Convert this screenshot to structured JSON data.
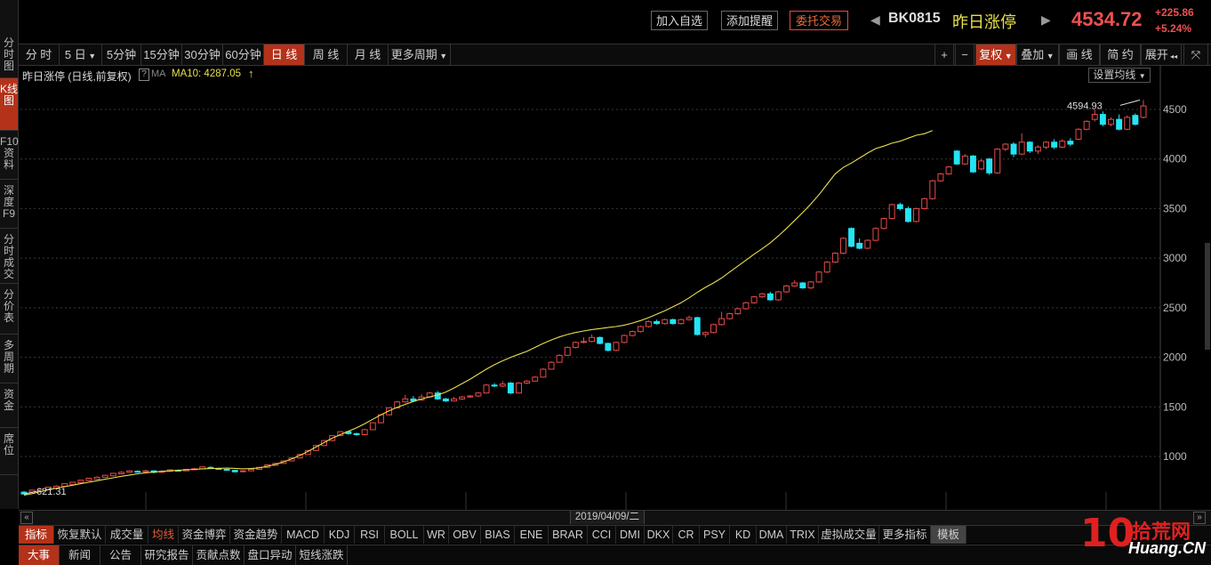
{
  "left_tabs": [
    "分时图",
    "K线图",
    "F10资料",
    "深度F9",
    "分时成交",
    "分价表",
    "多周期",
    "资金",
    "席位"
  ],
  "left_active": "K线图",
  "header": {
    "btn_add_watch": "加入自选",
    "btn_add_alert": "添加提醒",
    "btn_trade": "委托交易",
    "code": "BK0815",
    "name": "昨日涨停",
    "price": "4534.72",
    "change": "+225.86",
    "change_pct": "+5.24%"
  },
  "periods": [
    "分 时",
    "5 日",
    "5分钟",
    "15分钟",
    "30分钟",
    "60分钟",
    "日 线",
    "周 线",
    "月 线",
    "更多周期"
  ],
  "period_active": "日 线",
  "right_toolbar": {
    "plus": "+",
    "minus": "−",
    "adjust": "复权",
    "overlay": "叠加",
    "draw": "画 线",
    "simple": "简 约",
    "expand": "展开"
  },
  "chart_info": {
    "title": "昨日涨停 (日线,前复权)",
    "help": "?",
    "ma_label": "MA",
    "ma10": "MA10: 4287.05",
    "ma_arrow": "↑",
    "set_ma_btn": "设置均线",
    "high_label": "4594.93",
    "low_label": "621.31",
    "date_label": "2019/04/09/二"
  },
  "colors": {
    "up": "#e84a4a",
    "down": "#23e4f4",
    "ma": "#e8e04a",
    "accent": "#b4321a"
  },
  "chart_data": {
    "type": "candlestick",
    "title": "昨日涨停 (日线,前复权)",
    "ylim": [
      500,
      4700
    ],
    "yticks": [
      1000,
      1500,
      2000,
      2500,
      3000,
      3500,
      4000,
      4500
    ],
    "series": [
      {
        "name": "MA10",
        "values": [
          610,
          625,
          645,
          665,
          680,
          695,
          710,
          725,
          740,
          755,
          770,
          785,
          800,
          812,
          825,
          835,
          842,
          850,
          855,
          860,
          865,
          870,
          875,
          878,
          880,
          882,
          880,
          875,
          878,
          885,
          900,
          920,
          945,
          975,
          1010,
          1050,
          1095,
          1140,
          1185,
          1220,
          1255,
          1290,
          1330,
          1375,
          1420,
          1460,
          1495,
          1525,
          1555,
          1580,
          1600,
          1620,
          1650,
          1690,
          1735,
          1780,
          1830,
          1880,
          1925,
          1965,
          2000,
          2030,
          2060,
          2100,
          2140,
          2175,
          2205,
          2230,
          2250,
          2265,
          2280,
          2290,
          2300,
          2310,
          2325,
          2345,
          2370,
          2400,
          2435,
          2470,
          2510,
          2550,
          2600,
          2655,
          2705,
          2750,
          2800,
          2860,
          2920,
          2980,
          3040,
          3095,
          3155,
          3225,
          3300,
          3380,
          3460,
          3545,
          3640,
          3745,
          3850,
          3915,
          3960,
          4010,
          4060,
          4105,
          4130,
          4160,
          4180,
          4210,
          4240,
          4255,
          4287
        ]
      }
    ],
    "candles": [
      [
        640,
        621,
        650,
        615
      ],
      [
        640,
        660,
        665,
        630
      ],
      [
        650,
        670,
        680,
        645
      ],
      [
        665,
        690,
        695,
        660
      ],
      [
        680,
        700,
        710,
        675
      ],
      [
        700,
        725,
        730,
        695
      ],
      [
        715,
        740,
        745,
        710
      ],
      [
        735,
        760,
        765,
        730
      ],
      [
        755,
        780,
        785,
        750
      ],
      [
        770,
        790,
        800,
        765
      ],
      [
        790,
        810,
        815,
        785
      ],
      [
        805,
        830,
        835,
        800
      ],
      [
        825,
        840,
        850,
        820
      ],
      [
        840,
        855,
        860,
        835
      ],
      [
        850,
        845,
        860,
        835
      ],
      [
        845,
        855,
        865,
        840
      ],
      [
        855,
        840,
        860,
        830
      ],
      [
        840,
        850,
        860,
        835
      ],
      [
        850,
        865,
        870,
        845
      ],
      [
        860,
        855,
        870,
        850
      ],
      [
        855,
        870,
        875,
        850
      ],
      [
        870,
        875,
        885,
        860
      ],
      [
        875,
        895,
        900,
        870
      ],
      [
        890,
        880,
        900,
        875
      ],
      [
        880,
        870,
        885,
        865
      ],
      [
        870,
        860,
        880,
        855
      ],
      [
        860,
        845,
        865,
        840
      ],
      [
        850,
        855,
        860,
        840
      ],
      [
        855,
        870,
        875,
        850
      ],
      [
        870,
        890,
        895,
        865
      ],
      [
        890,
        915,
        920,
        885
      ],
      [
        910,
        930,
        935,
        905
      ],
      [
        930,
        955,
        960,
        925
      ],
      [
        955,
        985,
        990,
        950
      ],
      [
        985,
        1020,
        1025,
        980
      ],
      [
        1020,
        1060,
        1065,
        1015
      ],
      [
        1060,
        1110,
        1115,
        1055
      ],
      [
        1110,
        1160,
        1165,
        1105
      ],
      [
        1160,
        1210,
        1215,
        1155
      ],
      [
        1210,
        1250,
        1255,
        1205
      ],
      [
        1250,
        1230,
        1260,
        1220
      ],
      [
        1230,
        1220,
        1240,
        1210
      ],
      [
        1220,
        1270,
        1280,
        1215
      ],
      [
        1270,
        1340,
        1345,
        1265
      ],
      [
        1340,
        1420,
        1425,
        1335
      ],
      [
        1420,
        1490,
        1495,
        1415
      ],
      [
        1490,
        1550,
        1560,
        1485
      ],
      [
        1550,
        1580,
        1620,
        1540
      ],
      [
        1580,
        1560,
        1610,
        1550
      ],
      [
        1570,
        1600,
        1630,
        1560
      ],
      [
        1600,
        1640,
        1650,
        1590
      ],
      [
        1640,
        1580,
        1660,
        1570
      ],
      [
        1580,
        1560,
        1590,
        1550
      ],
      [
        1560,
        1580,
        1600,
        1555
      ],
      [
        1580,
        1600,
        1610,
        1570
      ],
      [
        1600,
        1610,
        1620,
        1590
      ],
      [
        1610,
        1640,
        1650,
        1600
      ],
      [
        1640,
        1720,
        1730,
        1635
      ],
      [
        1720,
        1710,
        1740,
        1700
      ],
      [
        1710,
        1730,
        1760,
        1700
      ],
      [
        1740,
        1640,
        1750,
        1630
      ],
      [
        1640,
        1740,
        1750,
        1635
      ],
      [
        1740,
        1760,
        1770,
        1730
      ],
      [
        1760,
        1800,
        1810,
        1755
      ],
      [
        1800,
        1880,
        1890,
        1795
      ],
      [
        1880,
        1950,
        1960,
        1875
      ],
      [
        1950,
        2020,
        2030,
        1945
      ],
      [
        2020,
        2100,
        2110,
        2015
      ],
      [
        2100,
        2150,
        2160,
        2090
      ],
      [
        2150,
        2160,
        2200,
        2140
      ],
      [
        2160,
        2200,
        2230,
        2150
      ],
      [
        2200,
        2140,
        2210,
        2130
      ],
      [
        2140,
        2070,
        2150,
        2060
      ],
      [
        2070,
        2150,
        2160,
        2060
      ],
      [
        2150,
        2220,
        2230,
        2140
      ],
      [
        2220,
        2260,
        2270,
        2210
      ],
      [
        2260,
        2310,
        2320,
        2250
      ],
      [
        2310,
        2360,
        2370,
        2300
      ],
      [
        2360,
        2340,
        2380,
        2330
      ],
      [
        2340,
        2380,
        2390,
        2330
      ],
      [
        2380,
        2340,
        2390,
        2330
      ],
      [
        2340,
        2380,
        2390,
        2330
      ],
      [
        2380,
        2400,
        2420,
        2370
      ],
      [
        2400,
        2230,
        2410,
        2220
      ],
      [
        2230,
        2250,
        2260,
        2200
      ],
      [
        2250,
        2330,
        2340,
        2240
      ],
      [
        2330,
        2390,
        2460,
        2320
      ],
      [
        2390,
        2440,
        2450,
        2380
      ],
      [
        2440,
        2490,
        2500,
        2430
      ],
      [
        2490,
        2550,
        2560,
        2480
      ],
      [
        2550,
        2610,
        2620,
        2540
      ],
      [
        2610,
        2640,
        2650,
        2600
      ],
      [
        2640,
        2580,
        2660,
        2570
      ],
      [
        2580,
        2660,
        2670,
        2570
      ],
      [
        2660,
        2720,
        2730,
        2650
      ],
      [
        2720,
        2750,
        2780,
        2710
      ],
      [
        2750,
        2700,
        2760,
        2690
      ],
      [
        2700,
        2760,
        2770,
        2690
      ],
      [
        2760,
        2860,
        2870,
        2750
      ],
      [
        2860,
        2960,
        2970,
        2850
      ],
      [
        2960,
        3050,
        3060,
        2950
      ],
      [
        3050,
        3200,
        3210,
        3040
      ],
      [
        3300,
        3120,
        3310,
        3110
      ],
      [
        3150,
        3100,
        3200,
        3090
      ],
      [
        3100,
        3180,
        3190,
        3090
      ],
      [
        3180,
        3300,
        3310,
        3170
      ],
      [
        3300,
        3400,
        3410,
        3290
      ],
      [
        3400,
        3540,
        3550,
        3390
      ],
      [
        3540,
        3500,
        3560,
        3480
      ],
      [
        3500,
        3370,
        3520,
        3360
      ],
      [
        3370,
        3500,
        3510,
        3360
      ],
      [
        3500,
        3600,
        3610,
        3490
      ],
      [
        3600,
        3780,
        3790,
        3590
      ],
      [
        3780,
        3850,
        3860,
        3770
      ],
      [
        3850,
        3920,
        3930,
        3840
      ],
      [
        4080,
        3950,
        4090,
        3940
      ],
      [
        3950,
        4030,
        4050,
        3940
      ],
      [
        4030,
        3870,
        4040,
        3860
      ],
      [
        3900,
        3980,
        4000,
        3890
      ],
      [
        4000,
        3860,
        4010,
        3840
      ],
      [
        3860,
        4100,
        4110,
        3850
      ],
      [
        4100,
        4150,
        4160,
        4080
      ],
      [
        4150,
        4050,
        4170,
        4020
      ],
      [
        4050,
        4170,
        4260,
        4040
      ],
      [
        4170,
        4080,
        4180,
        4060
      ],
      [
        4080,
        4120,
        4140,
        4050
      ],
      [
        4120,
        4170,
        4180,
        4100
      ],
      [
        4170,
        4120,
        4200,
        4100
      ],
      [
        4120,
        4180,
        4200,
        4110
      ],
      [
        4180,
        4150,
        4210,
        4130
      ],
      [
        4200,
        4300,
        4310,
        4190
      ],
      [
        4300,
        4380,
        4390,
        4290
      ],
      [
        4400,
        4450,
        4500,
        4380
      ],
      [
        4450,
        4350,
        4480,
        4330
      ],
      [
        4350,
        4400,
        4420,
        4330
      ],
      [
        4400,
        4300,
        4450,
        4290
      ],
      [
        4300,
        4420,
        4440,
        4290
      ],
      [
        4440,
        4350,
        4460,
        4340
      ],
      [
        4420,
        4535,
        4595,
        4410
      ]
    ]
  },
  "scroll": {
    "left": "«",
    "right": "»"
  },
  "indicators": [
    "指标",
    "恢复默认",
    "成交量",
    "均线",
    "资金博弈",
    "资金趋势",
    "MACD",
    "KDJ",
    "RSI",
    "BOLL",
    "WR",
    "OBV",
    "BIAS",
    "ENE",
    "BRAR",
    "CCI",
    "DMI",
    "DKX",
    "CR",
    "PSY",
    "KD",
    "DMA",
    "TRIX",
    "虚拟成交量",
    "更多指标",
    "模板"
  ],
  "news_tabs": [
    "大事",
    "新闻",
    "公告",
    "研究报告",
    "贡献点数",
    "盘口异动",
    "短线涨跌"
  ],
  "watermark": {
    "number": "10",
    "site": "Huang.CN",
    "cn": "拾荒网"
  }
}
